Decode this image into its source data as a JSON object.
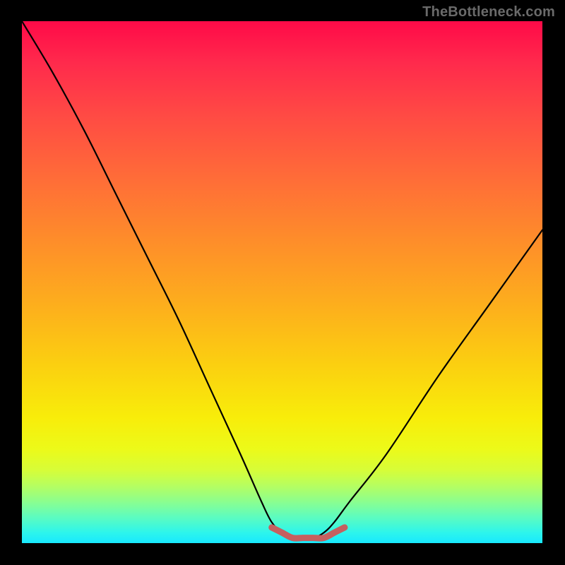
{
  "watermark": "TheBottleneck.com",
  "chart_data": {
    "type": "line",
    "title": "",
    "xlabel": "",
    "ylabel": "",
    "xlim": [
      0,
      100
    ],
    "ylim": [
      0,
      100
    ],
    "grid": false,
    "series": [
      {
        "name": "black-curve",
        "color": "#000000",
        "x": [
          0,
          6,
          12,
          18,
          24,
          30,
          36,
          42,
          46,
          48,
          50,
          52,
          54,
          56,
          58,
          60,
          63,
          70,
          80,
          90,
          100
        ],
        "values": [
          100,
          90,
          79,
          67,
          55,
          43,
          30,
          17,
          8,
          4,
          2,
          1,
          1,
          1,
          2,
          4,
          8,
          17,
          32,
          46,
          60
        ]
      },
      {
        "name": "red-floor-band",
        "color": "#c56060",
        "x": [
          48,
          50,
          52,
          54,
          56,
          58,
          60,
          62
        ],
        "values": [
          3,
          2,
          1,
          1,
          1,
          1,
          2,
          3
        ]
      }
    ]
  }
}
